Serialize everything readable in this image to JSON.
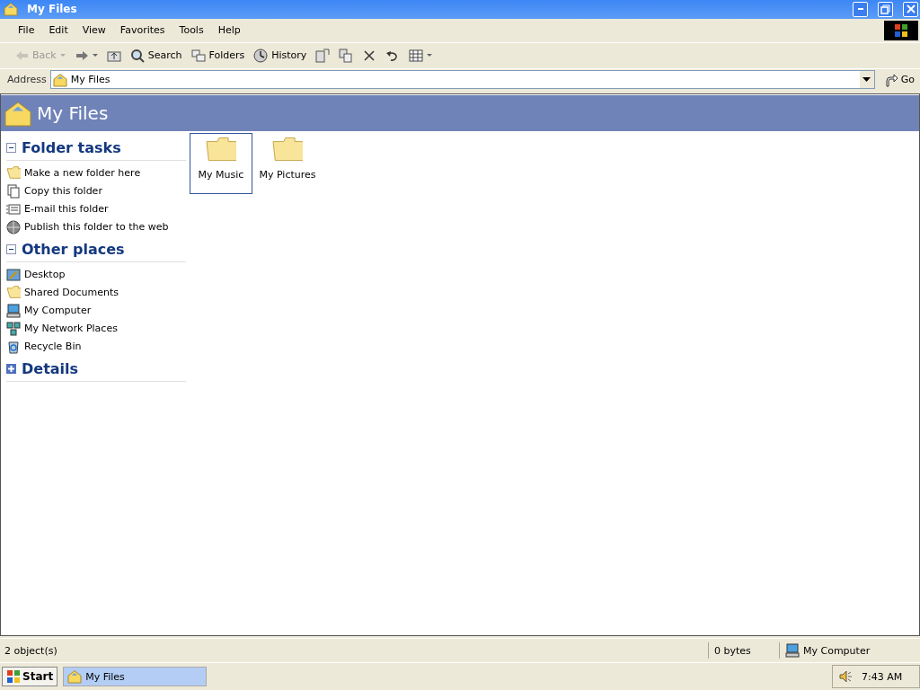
{
  "window": {
    "title": "My Files"
  },
  "menu": [
    "File",
    "Edit",
    "View",
    "Favorites",
    "Tools",
    "Help"
  ],
  "toolbar": [
    {
      "kind": "nav",
      "label": "Back",
      "disabled": true
    },
    {
      "kind": "nav",
      "disabled": false
    },
    {
      "kind": "icon",
      "disabled": false
    },
    {
      "kind": "labeled",
      "label": "Search",
      "disabled": false
    },
    {
      "kind": "labeled",
      "label": "Folders",
      "disabled": false
    },
    {
      "kind": "labeled",
      "label": "History",
      "disabled": false
    },
    {
      "kind": "icon",
      "disabled": false
    },
    {
      "kind": "icon",
      "disabled": false
    },
    {
      "kind": "icon",
      "disabled": false
    },
    {
      "kind": "icon",
      "disabled": false
    },
    {
      "kind": "views",
      "disabled": false
    }
  ],
  "address": {
    "label": "Address",
    "value": "My Files",
    "go": "Go"
  },
  "header": {
    "title": "My Files"
  },
  "sections": [
    {
      "title": "Folder tasks",
      "expanded": true,
      "items": [
        "Make a new folder here",
        "Copy this folder",
        "E-mail this folder",
        "Publish this folder to the web"
      ]
    },
    {
      "title": "Other places",
      "expanded": true,
      "items": [
        "Desktop",
        "Shared Documents",
        "My Computer",
        "My Network Places",
        "Recycle Bin"
      ]
    },
    {
      "title": "Details",
      "expanded": false
    }
  ],
  "files": [
    {
      "label": "My Music",
      "selected": true
    },
    {
      "label": "My Pictures",
      "selected": false
    }
  ],
  "status_bar": {
    "objects": "2 object(s)",
    "size": "0 bytes",
    "zone": "My Computer"
  },
  "taskbar": {
    "start": "Start",
    "tasks": [
      {
        "label": "My Files",
        "selected": true
      }
    ],
    "clock": "7:43 AM"
  }
}
